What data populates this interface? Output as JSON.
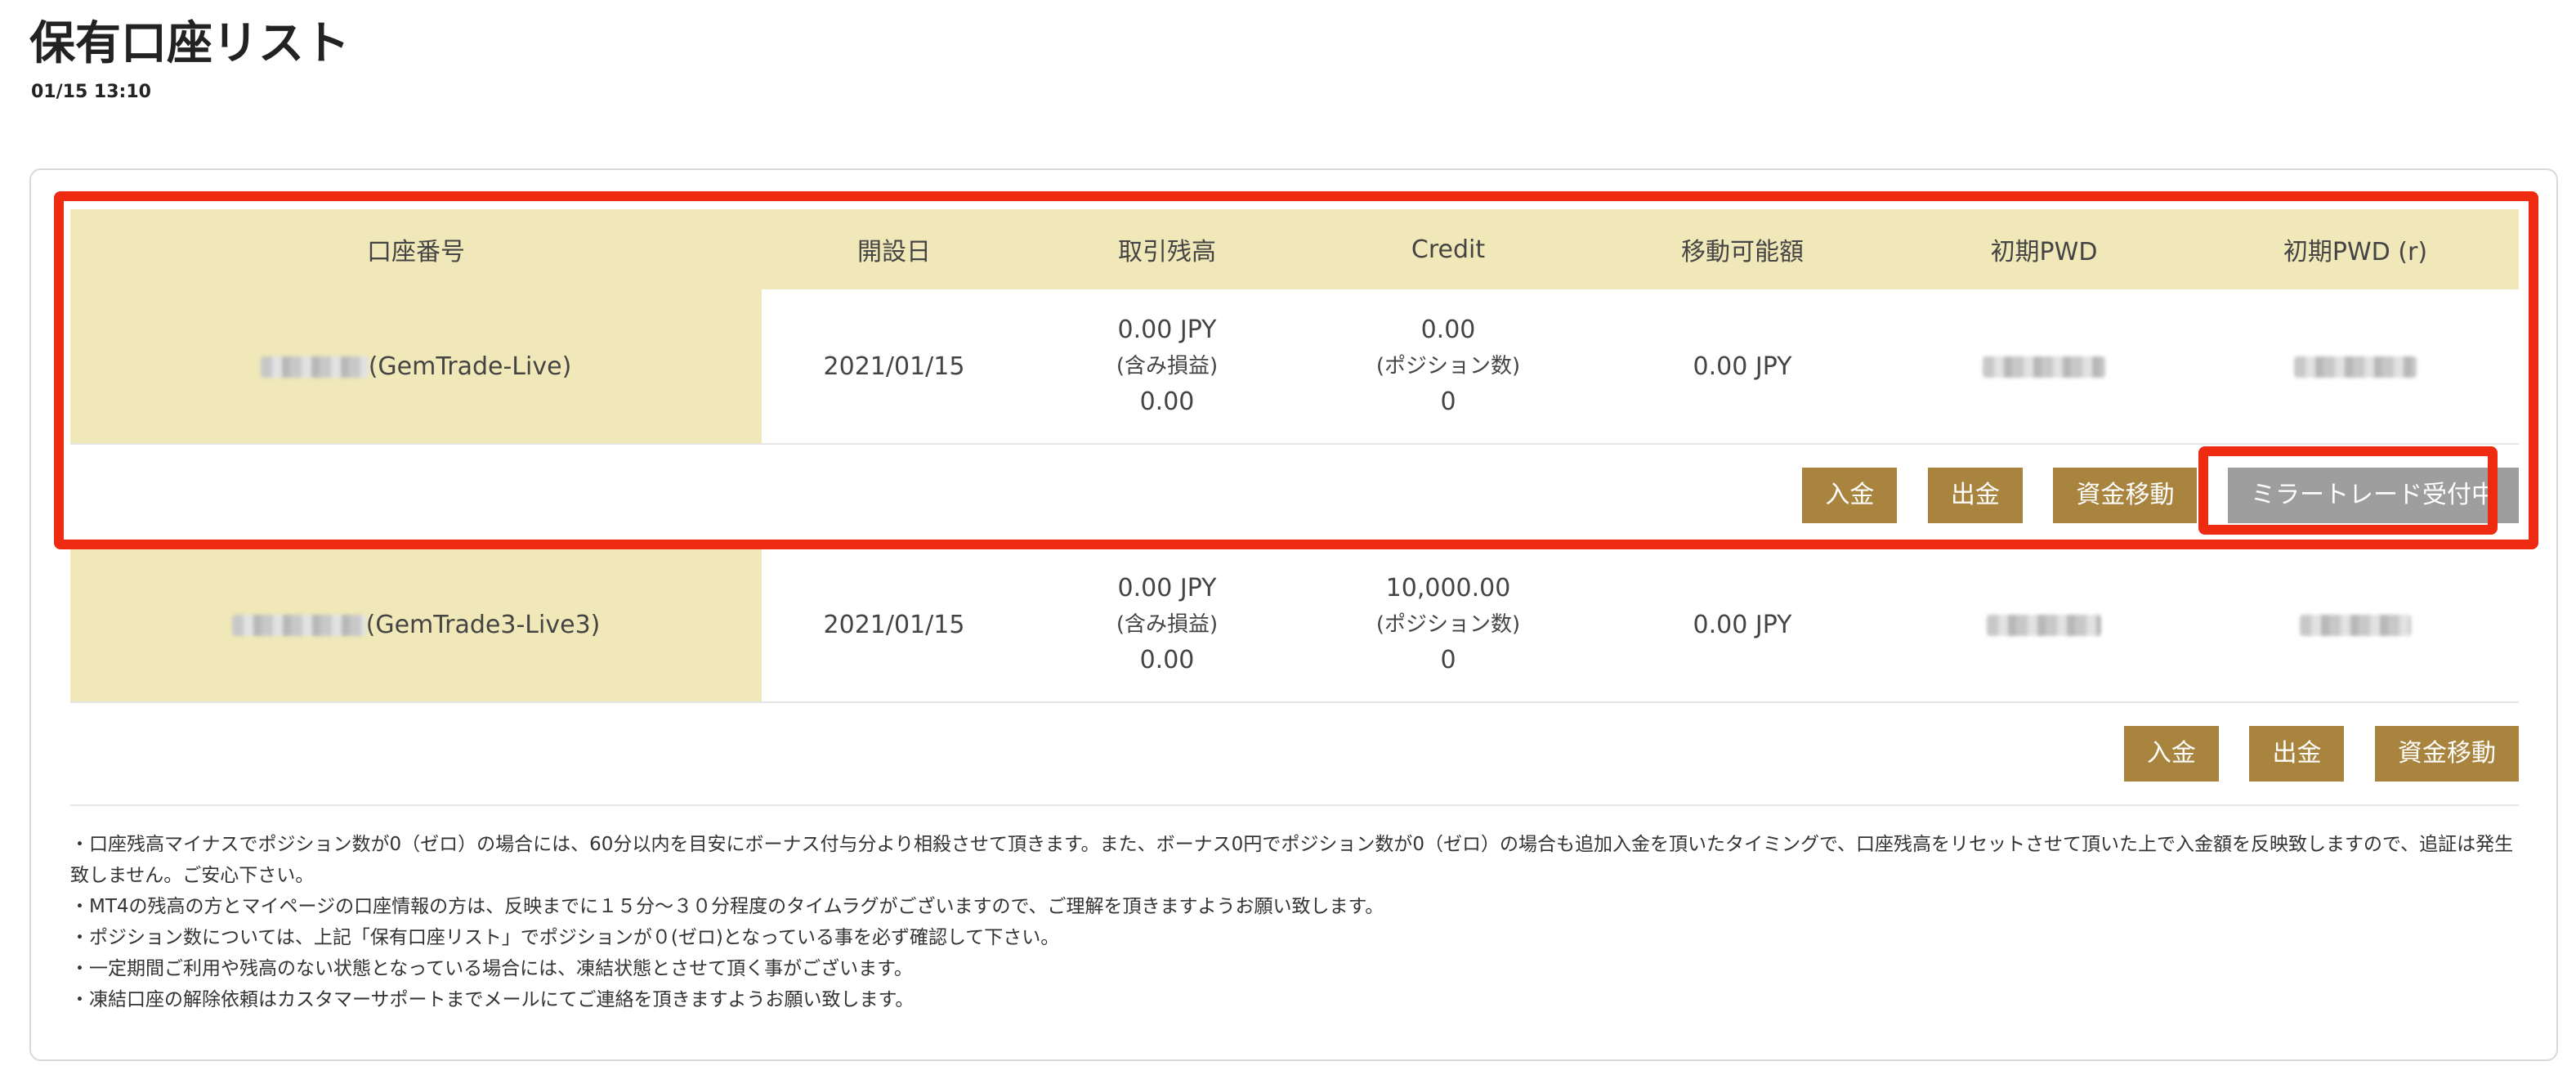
{
  "page": {
    "title": "保有口座リスト",
    "timestamp": "01/15 13:10"
  },
  "table": {
    "headers": [
      "口座番号",
      "開設日",
      "取引残高",
      "Credit",
      "移動可能額",
      "初期PWD",
      "初期PWD (r)"
    ],
    "rows": [
      {
        "account_suffix": "(GemTrade-Live)",
        "opened": "2021/01/15",
        "balance": "0.00 JPY",
        "balance_sub_label": "(含み損益)",
        "balance_sub_value": "0.00",
        "credit": "0.00",
        "credit_sub_label": "(ポジション数)",
        "credit_sub_value": "0",
        "transferable": "0.00 JPY",
        "buttons": [
          "入金",
          "出金",
          "資金移動",
          "ミラートレード受付中"
        ]
      },
      {
        "account_suffix": "(GemTrade3-Live3)",
        "opened": "2021/01/15",
        "balance": "0.00 JPY",
        "balance_sub_label": "(含み損益)",
        "balance_sub_value": "0.00",
        "credit": "10,000.00",
        "credit_sub_label": "(ポジション数)",
        "credit_sub_value": "0",
        "transferable": "0.00 JPY",
        "buttons": [
          "入金",
          "出金",
          "資金移動"
        ]
      }
    ]
  },
  "notes": [
    "・口座残高マイナスでポジション数が0（ゼロ）の場合には、60分以内を目安にボーナス付与分より相殺させて頂きます。また、ボーナス0円でポジション数が0（ゼロ）の場合も追加入金を頂いたタイミングで、口座残高をリセットさせて頂いた上で入金額を反映致しますので、追証は発生致しません。ご安心下さい。",
    "・MT4の残高の方とマイページの口座情報の方は、反映までに１５分～３０分程度のタイムラグがございますので、ご理解を頂きますようお願い致します。",
    "・ポジション数については、上記「保有口座リスト」でポジションが０(ゼロ)となっている事を必ず確認して下さい。",
    "・一定期間ご利用や残高のない状態となっている場合には、凍結状態とさせて頂く事がございます。",
    "・凍結口座の解除依頼はカスタマーサポートまでメールにてご連絡を頂きますようお願い致します。"
  ],
  "colors": {
    "header_bg": "#f0e8b8",
    "button_bg": "#a9843e",
    "button_disabled_bg": "#9e9e9e",
    "highlight": "#ee2a10"
  }
}
